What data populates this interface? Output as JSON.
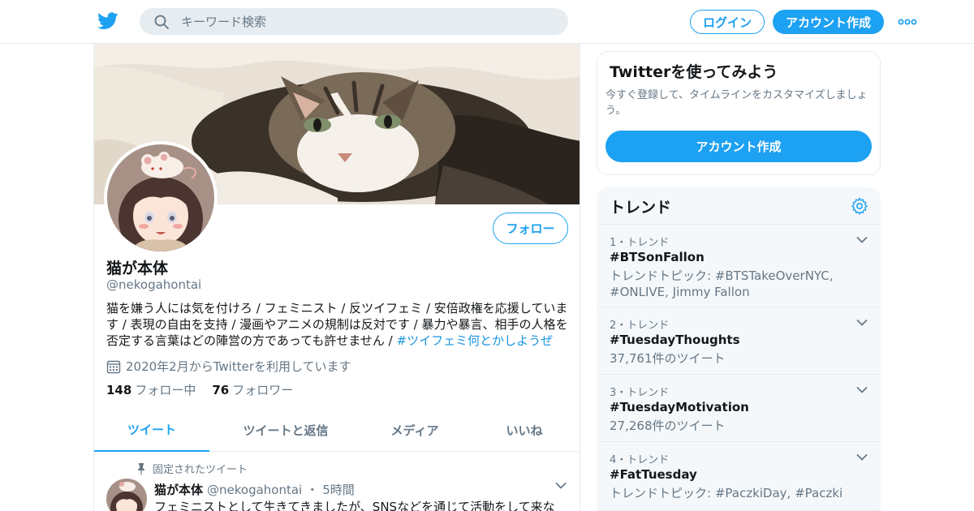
{
  "colors": {
    "brand": "#1da1f2",
    "text": "#14171a",
    "muted": "#657786",
    "border": "#e6ecf0",
    "link": "#1b95e0"
  },
  "header": {
    "logo_icon": "twitter-bird-icon",
    "search_placeholder": "キーワード検索",
    "login_label": "ログイン",
    "signup_label": "アカウント作成",
    "more_icon": "more-dots-icon"
  },
  "profile": {
    "name": "猫が本体",
    "handle": "@nekogahontai",
    "follow_label": "フォロー",
    "bio_text": "猫を嫌う人には気を付けろ / フェミニスト / 反ツイフェミ / 安倍政権を応援しています / 表現の自由を支持 / 漫画やアニメの規制は反対です / 暴力や暴言、相手の人格を否定する言葉はどの陣営の方であっても許せません / ",
    "bio_hashtag": "#ツイフェミ何とかしようぜ",
    "joined": "2020年2月からTwitterを利用しています",
    "following_count": "148",
    "following_label": "フォロー中",
    "followers_count": "76",
    "followers_label": "フォロワー"
  },
  "tabs": [
    {
      "label": "ツイート",
      "active": true
    },
    {
      "label": "ツイートと返信",
      "active": false
    },
    {
      "label": "メディア",
      "active": false
    },
    {
      "label": "いいね",
      "active": false
    }
  ],
  "tweet": {
    "pinned_label": "固定されたツイート",
    "name": "猫が本体",
    "handle": "@nekogahontai",
    "separator": "・",
    "time": "5時間",
    "text": "フェミニストとして生きてきましたが、SNSなどを通じて活動をして来な"
  },
  "signup_card": {
    "title": "Twitterを使ってみよう",
    "description": "今すぐ登録して、タイムラインをカスタマイズしましょう。",
    "button_label": "アカウント作成"
  },
  "trends": {
    "title": "トレンド",
    "items": [
      {
        "meta": "1・トレンド",
        "name": "#BTSonFallon",
        "desc": "トレンドトピック: #BTSTakeOverNYC, #ONLIVE, Jimmy Fallon"
      },
      {
        "meta": "2・トレンド",
        "name": "#TuesdayThoughts",
        "desc": "37,761件のツイート"
      },
      {
        "meta": "3・トレンド",
        "name": "#TuesdayMotivation",
        "desc": "27,268件のツイート"
      },
      {
        "meta": "4・トレンド",
        "name": "#FatTuesday",
        "desc": "トレンドトピック: #PaczkiDay, #Paczki"
      }
    ]
  }
}
